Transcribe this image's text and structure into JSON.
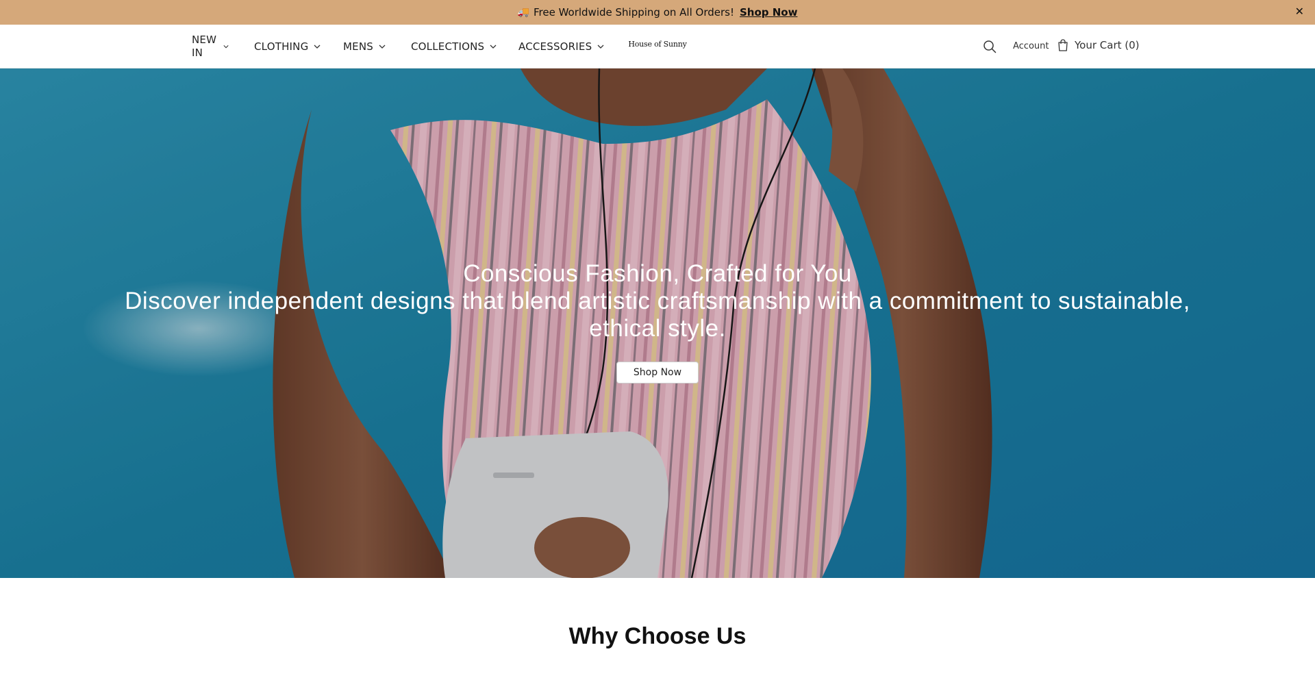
{
  "announcement": {
    "emoji": "🚚",
    "text": "Free Worldwide Shipping on All Orders!",
    "link_label": "Shop Now",
    "close_label": "✕",
    "background": "#d5a87a"
  },
  "nav": {
    "items": [
      {
        "label": "NEW IN"
      },
      {
        "label": "CLOTHING"
      },
      {
        "label": "MENS"
      },
      {
        "label": "COLLECTIONS"
      },
      {
        "label": "ACCESSORIES"
      }
    ],
    "logo": "House of Sunny",
    "account_label": "Account",
    "cart_label": "Your Cart (0)"
  },
  "hero": {
    "title": "Conscious Fashion, Crafted for You",
    "subtitle": "Discover independent designs that blend artistic craftsmanship with a commitment to sustainable, ethical style.",
    "button_label": "Shop Now",
    "background_color": "#1e7fa0"
  },
  "why": {
    "heading": "Why Choose Us"
  }
}
